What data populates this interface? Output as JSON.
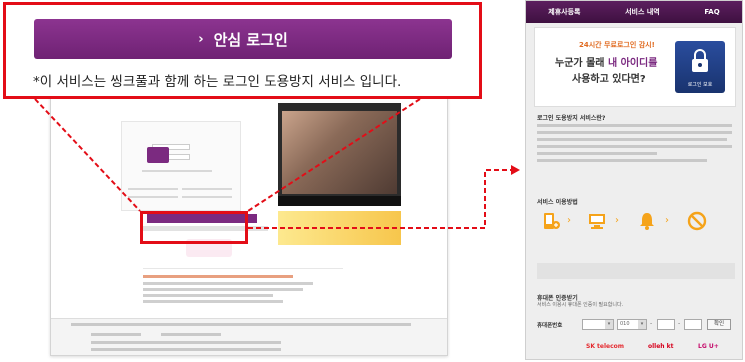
{
  "callout": {
    "button_label": "안심 로그인",
    "button_chevron": "›",
    "note": "*이 서비스는 씽크풀과 함께 하는 로그인 도용방지 서비스 입니다."
  },
  "panel": {
    "nav": [
      "제휴사등록",
      "서비스 내역",
      "FAQ"
    ],
    "promo_sub": "24시간 무료로그인 감시!",
    "promo_line1_pre": "누군가 몰래 ",
    "promo_line1_hl": "내 아이디를",
    "promo_line2": "사용하고 있다면?",
    "lock_label": "로그인 보호",
    "about_title": "로그인 도용방지 서비스란?",
    "service_title": "서비스 이용방법",
    "auth_title": "휴대폰 인증받기",
    "auth_desc": "서비스 이용시 휴대폰 인증이 필요합니다.",
    "phone_label": "휴대폰번호",
    "phone_prefix": "010",
    "confirm_label": "확인",
    "carriers": [
      {
        "name": "SK telecom",
        "color": "#e4282d"
      },
      {
        "name": "olleh kt",
        "color": "#d6001c"
      },
      {
        "name": "LG U+",
        "color": "#c40a6a"
      }
    ]
  },
  "colors": {
    "accent_purple": "#7b2a80",
    "highlight_red": "#e30d17",
    "step_orange": "#f5a31a"
  }
}
